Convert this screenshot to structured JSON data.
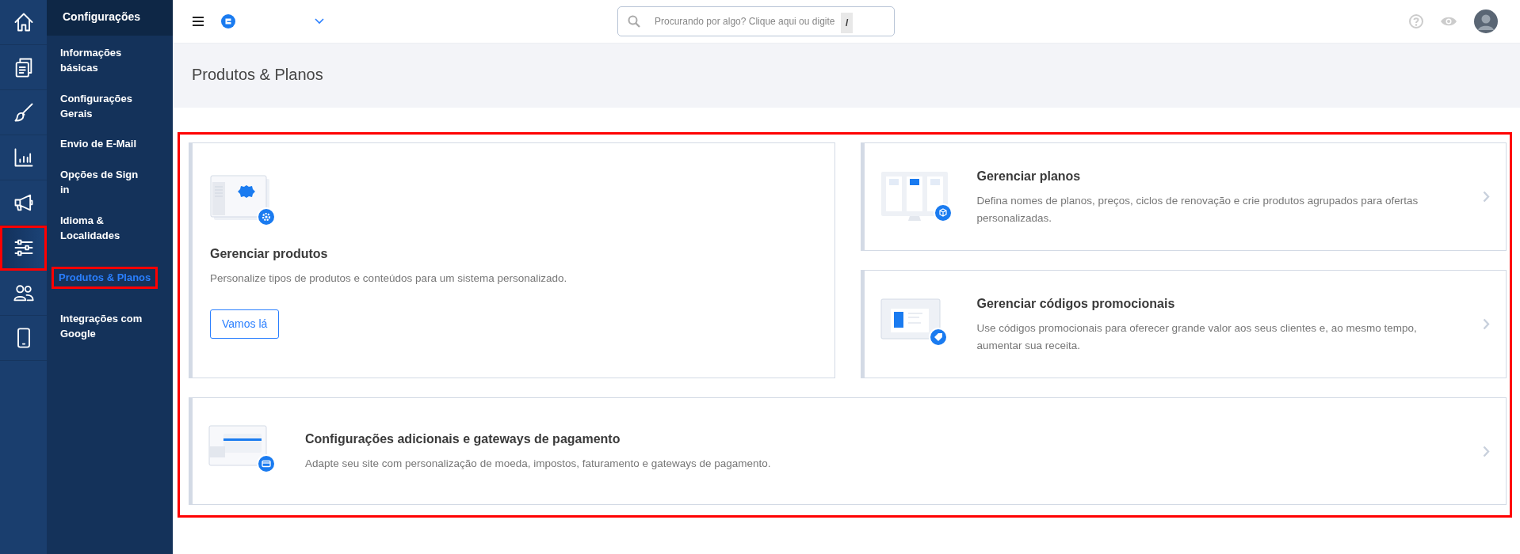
{
  "rail": [
    {
      "kind": "home",
      "selected": false,
      "highlighted": false
    },
    {
      "kind": "pages",
      "selected": false,
      "highlighted": false
    },
    {
      "kind": "brush",
      "selected": false,
      "highlighted": false
    },
    {
      "kind": "chart",
      "selected": false,
      "highlighted": false
    },
    {
      "kind": "megaphone",
      "selected": false,
      "highlighted": false
    },
    {
      "kind": "sliders",
      "selected": true,
      "highlighted": true
    },
    {
      "kind": "users",
      "selected": false,
      "highlighted": false
    },
    {
      "kind": "mobile",
      "selected": false,
      "highlighted": false
    }
  ],
  "submenu": {
    "title": "Configurações",
    "items": [
      {
        "label": "Informações básicas",
        "selected": false,
        "highlighted": false
      },
      {
        "label": "Configurações Gerais",
        "selected": false,
        "highlighted": false
      },
      {
        "label": "Envio de E-Mail",
        "selected": false,
        "highlighted": false
      },
      {
        "label": "Opções de Sign in",
        "selected": false,
        "highlighted": false
      },
      {
        "label": "Idioma & Localidades",
        "selected": false,
        "highlighted": false
      },
      {
        "label": "Produtos & Planos",
        "selected": true,
        "highlighted": true
      },
      {
        "label": "Integrações com Google",
        "selected": false,
        "highlighted": false
      }
    ]
  },
  "topbar": {
    "search": {
      "placeholder": "Procurando por algo? Clique aqui ou digite",
      "shortcut": "/"
    }
  },
  "page": {
    "title": "Produtos & Planos",
    "content_highlighted": true
  },
  "cards": [
    {
      "kind": "products",
      "title": "Gerenciar produtos",
      "description": "Personalize tipos de produtos e conteúdos para um sistema personalizado.",
      "button": "Vamos lá"
    },
    {
      "kind": "plans",
      "title": "Gerenciar planos",
      "description": "Defina nomes de planos, preços, ciclos de renovação e crie produtos agrupados para ofertas personalizadas."
    },
    {
      "kind": "promo",
      "title": "Gerenciar códigos promocionais",
      "description": "Use códigos promocionais para oferecer grande valor aos seus clientes e, ao mesmo tempo, aumentar sua receita."
    },
    {
      "kind": "payments",
      "title": "Configurações adicionais e gateways de pagamento",
      "description": "Adapte seu site com personalização de moeda, impostos, faturamento e gateways de pagamento."
    }
  ]
}
